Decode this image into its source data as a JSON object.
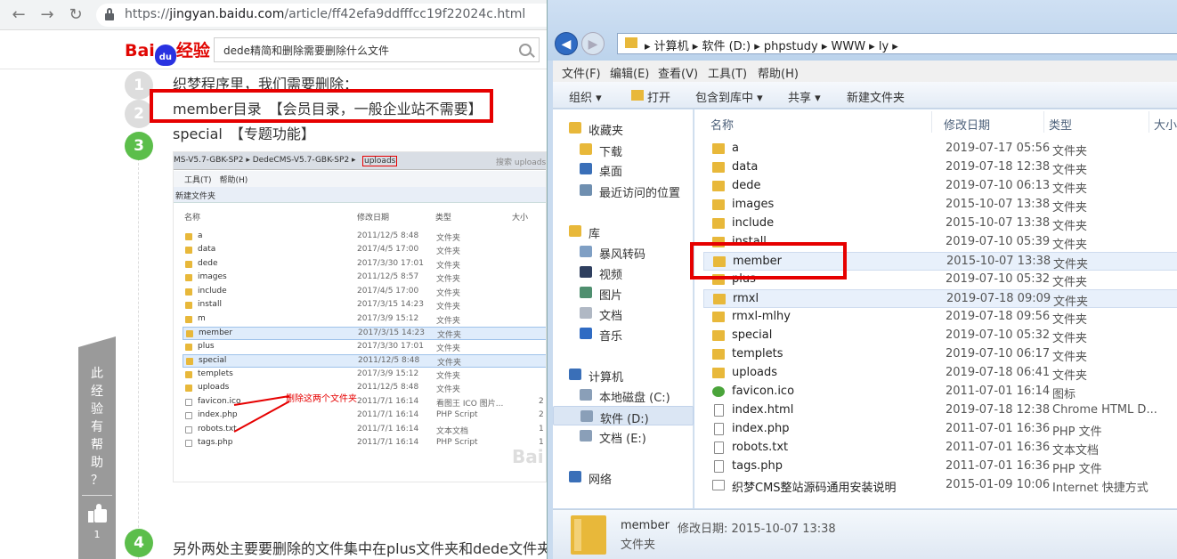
{
  "browser": {
    "url_scheme": "https://",
    "url_domain": "jingyan.baidu.com",
    "url_path": "/article/ff42efa9ddfffcc19f22024c.html"
  },
  "baidu": {
    "logo_bai": "Bai",
    "logo_du": "du",
    "logo_jingyan": "经验",
    "search_value": "dede精简和删除需要删除什么文件"
  },
  "article": {
    "steps": [
      "1",
      "2",
      "3",
      "4"
    ],
    "line1": "织梦程序里，我们需要删除：",
    "line2": "member目录　【会员目录，一般企业站不需要】",
    "line3": "special　【专题功能】",
    "line4": "另外两处主要要删除的文件集中在plus文件夹和dede文件夹"
  },
  "embedded": {
    "breadcrumb": "MS-V5.7-GBK-SP2 ▸ DedeCMS-V5.7-GBK-SP2 ▸",
    "breadcrumb_highlight": "uploads",
    "search_placeholder": "搜索 uploads",
    "menu": "工具(T)　帮助(H)",
    "toolbar": "新建文件夹",
    "headers": {
      "name": "名称",
      "date": "修改日期",
      "type": "类型",
      "size": "大小"
    },
    "note": "删除这两个文件夹",
    "rows": [
      {
        "name": "a",
        "date": "2011/12/5 8:48",
        "type": "文件夹",
        "size": ""
      },
      {
        "name": "data",
        "date": "2017/4/5 17:00",
        "type": "文件夹",
        "size": ""
      },
      {
        "name": "dede",
        "date": "2017/3/30 17:01",
        "type": "文件夹",
        "size": ""
      },
      {
        "name": "images",
        "date": "2011/12/5 8:57",
        "type": "文件夹",
        "size": ""
      },
      {
        "name": "include",
        "date": "2017/4/5 17:00",
        "type": "文件夹",
        "size": ""
      },
      {
        "name": "install",
        "date": "2017/3/15 14:23",
        "type": "文件夹",
        "size": ""
      },
      {
        "name": "m",
        "date": "2017/3/9 15:12",
        "type": "文件夹",
        "size": ""
      },
      {
        "name": "member",
        "date": "2017/3/15 14:23",
        "type": "文件夹",
        "size": ""
      },
      {
        "name": "plus",
        "date": "2017/3/30 17:01",
        "type": "文件夹",
        "size": ""
      },
      {
        "name": "special",
        "date": "2011/12/5 8:48",
        "type": "文件夹",
        "size": ""
      },
      {
        "name": "templets",
        "date": "2017/3/9 15:12",
        "type": "文件夹",
        "size": ""
      },
      {
        "name": "uploads",
        "date": "2011/12/5 8:48",
        "type": "文件夹",
        "size": ""
      },
      {
        "name": "favicon.ico",
        "date": "2011/7/1 16:14",
        "type": "看图王 ICO 图片...",
        "size": "2"
      },
      {
        "name": "index.php",
        "date": "2011/7/1 16:14",
        "type": "PHP Script",
        "size": "2"
      },
      {
        "name": "robots.txt",
        "date": "2011/7/1 16:14",
        "type": "文本文档",
        "size": "1"
      },
      {
        "name": "tags.php",
        "date": "2011/7/1 16:14",
        "type": "PHP Script",
        "size": "1"
      }
    ],
    "watermark": "Bai"
  },
  "side": {
    "text": [
      "此",
      "经",
      "验",
      "有",
      "帮",
      "助",
      "？"
    ],
    "count": "1"
  },
  "explorer": {
    "path": "▸ 计算机 ▸ 软件 (D:) ▸ phpstudy ▸ WWW ▸ ly ▸",
    "menu": [
      "文件(F)",
      "编辑(E)",
      "查看(V)",
      "工具(T)",
      "帮助(H)"
    ],
    "toolbar": [
      "组织 ▾",
      "打开",
      "包含到库中 ▾",
      "共享 ▾",
      "新建文件夹"
    ],
    "nav": [
      {
        "label": "收藏夹",
        "icon": "star-icon",
        "color": "#e8b83a"
      },
      {
        "label": "下载",
        "icon": "downloads-icon",
        "color": "#e8b83a"
      },
      {
        "label": "桌面",
        "icon": "desktop-icon",
        "color": "#3a6fb8"
      },
      {
        "label": "最近访问的位置",
        "icon": "recent-places-icon",
        "color": "#6f8fb0"
      },
      {
        "label": "库",
        "icon": "libraries-icon",
        "color": "#e8b83a"
      },
      {
        "label": "暴风转码",
        "icon": "library-folder-icon",
        "color": "#7f9fc4"
      },
      {
        "label": "视频",
        "icon": "video-icon",
        "color": "#2f3f5f"
      },
      {
        "label": "图片",
        "icon": "pictures-icon",
        "color": "#4f8f6f"
      },
      {
        "label": "文档",
        "icon": "documents-icon",
        "color": "#b0b8c4"
      },
      {
        "label": "音乐",
        "icon": "music-icon",
        "color": "#2f6bc3"
      },
      {
        "label": "计算机",
        "icon": "computer-icon",
        "color": "#3a6fb8"
      },
      {
        "label": "本地磁盘 (C:)",
        "icon": "drive-c-icon",
        "color": "#8a9fb8"
      },
      {
        "label": "软件 (D:)",
        "icon": "drive-d-icon",
        "color": "#8a9fb8"
      },
      {
        "label": "文档 (E:)",
        "icon": "drive-e-icon",
        "color": "#8a9fb8"
      },
      {
        "label": "网络",
        "icon": "network-icon",
        "color": "#3a6fb8"
      }
    ],
    "columns": {
      "name": "名称",
      "date": "修改日期",
      "type": "类型",
      "size": "大小"
    },
    "files": [
      {
        "name": "a",
        "date": "2019-07-17 05:56",
        "type": "文件夹",
        "kind": "folder"
      },
      {
        "name": "data",
        "date": "2019-07-18 12:38",
        "type": "文件夹",
        "kind": "folder"
      },
      {
        "name": "dede",
        "date": "2019-07-10 06:13",
        "type": "文件夹",
        "kind": "folder"
      },
      {
        "name": "images",
        "date": "2015-10-07 13:38",
        "type": "文件夹",
        "kind": "folder"
      },
      {
        "name": "include",
        "date": "2015-10-07 13:38",
        "type": "文件夹",
        "kind": "folder"
      },
      {
        "name": "install",
        "date": "2019-07-10 05:39",
        "type": "文件夹",
        "kind": "folder"
      },
      {
        "name": "member",
        "date": "2015-10-07 13:38",
        "type": "文件夹",
        "kind": "folder"
      },
      {
        "name": "plus",
        "date": "2019-07-10 05:32",
        "type": "文件夹",
        "kind": "folder"
      },
      {
        "name": "rmxl",
        "date": "2019-07-18 09:09",
        "type": "文件夹",
        "kind": "folder"
      },
      {
        "name": "rmxl-mlhy",
        "date": "2019-07-18 09:56",
        "type": "文件夹",
        "kind": "folder"
      },
      {
        "name": "special",
        "date": "2019-07-10 05:32",
        "type": "文件夹",
        "kind": "folder"
      },
      {
        "name": "templets",
        "date": "2019-07-10 06:17",
        "type": "文件夹",
        "kind": "folder"
      },
      {
        "name": "uploads",
        "date": "2019-07-18 06:41",
        "type": "文件夹",
        "kind": "folder"
      },
      {
        "name": "favicon.ico",
        "date": "2011-07-01 16:14",
        "type": "图标",
        "kind": "ico"
      },
      {
        "name": "index.html",
        "date": "2019-07-18 12:38",
        "type": "Chrome HTML D...",
        "kind": "doc"
      },
      {
        "name": "index.php",
        "date": "2011-07-01 16:36",
        "type": "PHP 文件",
        "kind": "doc"
      },
      {
        "name": "robots.txt",
        "date": "2011-07-01 16:36",
        "type": "文本文档",
        "kind": "doc"
      },
      {
        "name": "tags.php",
        "date": "2011-07-01 16:36",
        "type": "PHP 文件",
        "kind": "doc"
      },
      {
        "name": "织梦CMS整站源码通用安装说明",
        "date": "2015-01-09 10:06",
        "type": "Internet 快捷方式",
        "kind": "lnk"
      }
    ],
    "details": {
      "name": "member",
      "modified_label": "修改日期: 2015-10-07 13:38",
      "type": "文件夹"
    }
  },
  "colors": {
    "highlight_red": "#e60000",
    "step_green": "#5cbe4b",
    "step_gray": "#dddddd"
  }
}
